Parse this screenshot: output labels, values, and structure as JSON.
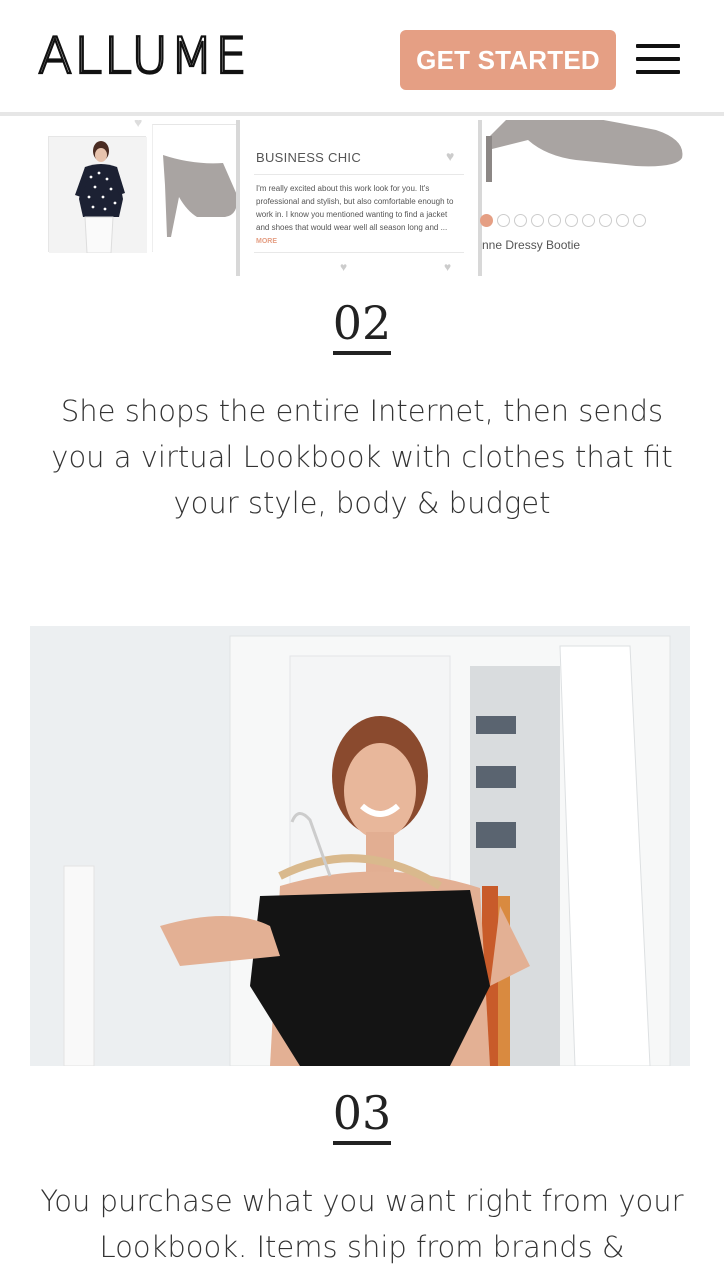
{
  "header": {
    "logo": "ALLUME",
    "cta_label": "GET STARTED",
    "menu_icon": "hamburger-icon"
  },
  "colors": {
    "accent": "#e59f84",
    "text": "#333333",
    "background": "#ffffff"
  },
  "mockup": {
    "card_title": "BUSINESS CHIC",
    "card_text": "I'm really excited about this work look for you. It's professional and stylish, but also comfortable enough to work in. I know you mentioned wanting to find a jacket and shoes that would wear well all season long and ...",
    "card_more": "MORE",
    "product_name": "nne Dressy Bootie",
    "carousel_count": 10,
    "carousel_active": 1
  },
  "steps": [
    {
      "number": "02",
      "text": "She shops the entire Internet, then sends you a virtual Lookbook with clothes that fit your style, body & budget"
    },
    {
      "number": "03",
      "text": "You purchase what you want right from your Lookbook. Items ship from brands &"
    }
  ]
}
